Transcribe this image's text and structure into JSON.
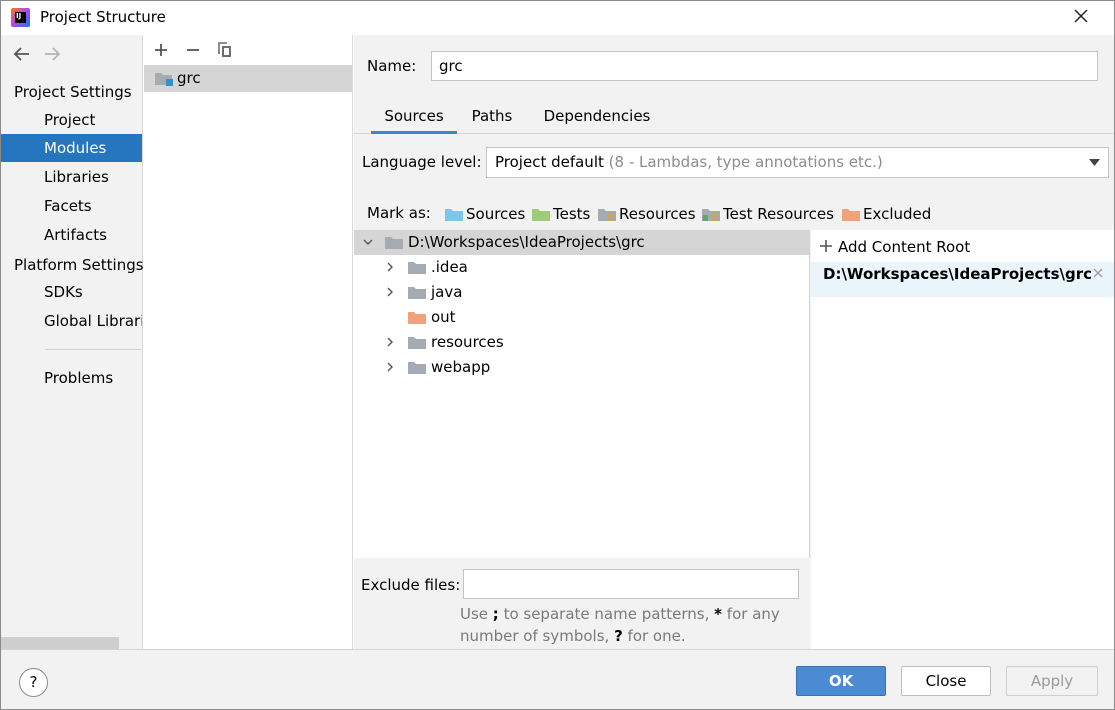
{
  "window": {
    "title": "Project Structure"
  },
  "leftnav": {
    "project_settings": "Project Settings",
    "platform_settings": "Platform Settings",
    "items": [
      {
        "label": "Project"
      },
      {
        "label": "Modules"
      },
      {
        "label": "Libraries"
      },
      {
        "label": "Facets"
      },
      {
        "label": "Artifacts"
      }
    ],
    "platform_items": [
      {
        "label": "SDKs"
      },
      {
        "label": "Global Librari"
      }
    ],
    "problems": "Problems"
  },
  "modules": {
    "items": [
      {
        "label": "grc"
      }
    ]
  },
  "content": {
    "name_label": "Name:",
    "name_value": "grc",
    "tabs": [
      {
        "label": "Sources"
      },
      {
        "label": "Paths"
      },
      {
        "label": "Dependencies"
      }
    ],
    "language_level_label": "Language level:",
    "language_level_value": "Project default",
    "language_level_detail": "(8 - Lambdas, type annotations etc.)",
    "mark_as_label": "Mark as:",
    "mark_as": [
      {
        "label": "Sources",
        "color": "#7fc5ea"
      },
      {
        "label": "Tests",
        "color": "#9ccc77"
      },
      {
        "label": "Resources",
        "color": "#a4abb2"
      },
      {
        "label": "Test Resources",
        "color": "#a4abb2"
      },
      {
        "label": "Excluded",
        "color": "#f0a27a"
      }
    ],
    "tree": {
      "root": "D:\\Workspaces\\IdeaProjects\\grc",
      "children": [
        {
          "label": ".idea",
          "expandable": true,
          "color": "#a4abb2"
        },
        {
          "label": "java",
          "expandable": true,
          "color": "#a4abb2"
        },
        {
          "label": "out",
          "expandable": false,
          "color": "#f0a27a"
        },
        {
          "label": "resources",
          "expandable": true,
          "color": "#a4abb2"
        },
        {
          "label": "webapp",
          "expandable": true,
          "color": "#a4abb2"
        }
      ]
    },
    "add_content_root": "Add Content Root",
    "content_root": "D:\\Workspaces\\IdeaProjects\\grc",
    "exclude_files_label": "Exclude files:",
    "exclude_files_value": "",
    "hint": {
      "p1": "Use ",
      "k1": ";",
      "p2": " to separate name patterns, ",
      "k2": "*",
      "p3": " for any number of symbols, ",
      "k3": "?",
      "p4": " for one."
    }
  },
  "footer": {
    "help": "?",
    "ok": "OK",
    "close": "Close",
    "apply": "Apply"
  },
  "colors": {
    "selection": "#2675bf",
    "primary": "#4a8bd4",
    "folder_gray": "#a4abb2"
  }
}
